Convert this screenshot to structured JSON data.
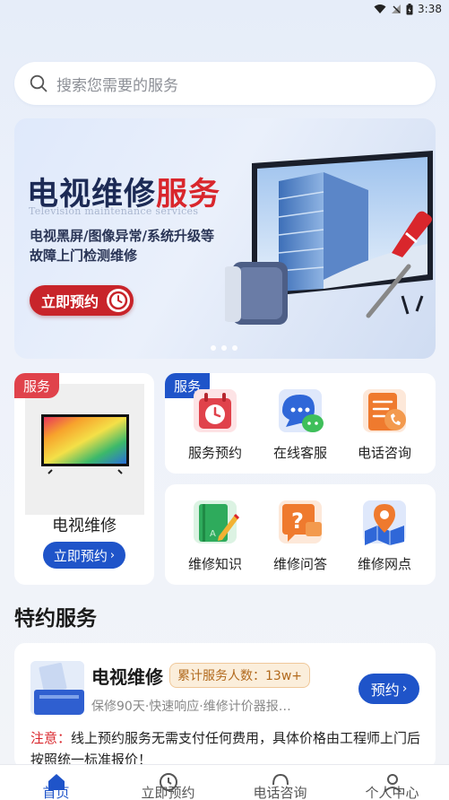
{
  "status_bar": {
    "time": "3:38"
  },
  "search": {
    "placeholder": "搜索您需要的服务"
  },
  "banner": {
    "title_main": "电视维修",
    "title_accent": "服务",
    "subtitle_en": "Television maintenance services",
    "desc_line1": "电视黑屏/图像异常/系统升级等",
    "desc_line2": "故障上门检测维修",
    "cta_label": "立即预约"
  },
  "tv_card": {
    "tag": "服务",
    "name": "电视维修",
    "button_label": "立即预约"
  },
  "service_grid": {
    "tag": "服务",
    "items": [
      {
        "label": "服务预约",
        "icon": "calendar-clock-icon"
      },
      {
        "label": "在线客服",
        "icon": "chat-bubble-icon"
      },
      {
        "label": "电话咨询",
        "icon": "phone-document-icon"
      }
    ]
  },
  "knowledge_grid": {
    "items": [
      {
        "label": "维修知识",
        "icon": "book-pencil-icon"
      },
      {
        "label": "维修问答",
        "icon": "question-chat-icon"
      },
      {
        "label": "维修网点",
        "icon": "map-pin-icon"
      }
    ]
  },
  "special": {
    "section_title": "特约服务",
    "service_name": "电视维修",
    "badge": "累计服务人数：13w+",
    "desc": "保修90天·快速响应·维修计价器报…",
    "button_label": "预约",
    "note_label": "注意：",
    "note_text": "线上预约服务无需支付任何费用，具体价格由工程师上门后按照统一标准报价！"
  },
  "tabbar": {
    "items": [
      {
        "label": "首页",
        "active": true
      },
      {
        "label": "立即预约",
        "active": false
      },
      {
        "label": "电话咨询",
        "active": false
      },
      {
        "label": "个人中心",
        "active": false
      }
    ]
  },
  "colors": {
    "primary": "#1f54c9",
    "accent_red": "#d9262c",
    "tag_red": "#e0424b"
  }
}
